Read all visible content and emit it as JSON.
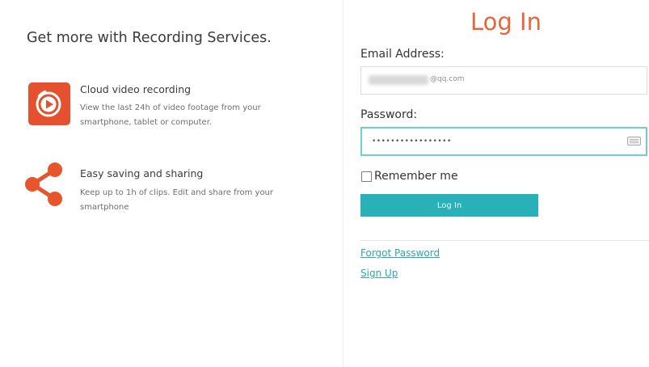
{
  "promo": {
    "title": "Get more with Recording Services.",
    "features": [
      {
        "icon": "video-play-icon",
        "title": "Cloud video recording",
        "description": "View the last 24h of video footage from your smartphone, tablet or computer."
      },
      {
        "icon": "share-icon",
        "title": "Easy saving and sharing",
        "description": "Keep up to 1h of clips. Edit and share from your smartphone"
      }
    ]
  },
  "login": {
    "heading": "Log In",
    "email_label": "Email Address:",
    "email_value_visible": "@qq.com",
    "password_label": "Password:",
    "password_value": "•••••••••••••••••",
    "remember_label": "Remember me",
    "remember_checked": false,
    "button_label": "Log In",
    "forgot_link": "Forgot Password",
    "signup_link": "Sign Up"
  },
  "colors": {
    "accent_orange": "#e9663c",
    "icon_orange": "#e5512f",
    "button_teal": "#29b0b8",
    "link_teal": "#2aa7b5",
    "focus_border": "#6bd0cf"
  }
}
